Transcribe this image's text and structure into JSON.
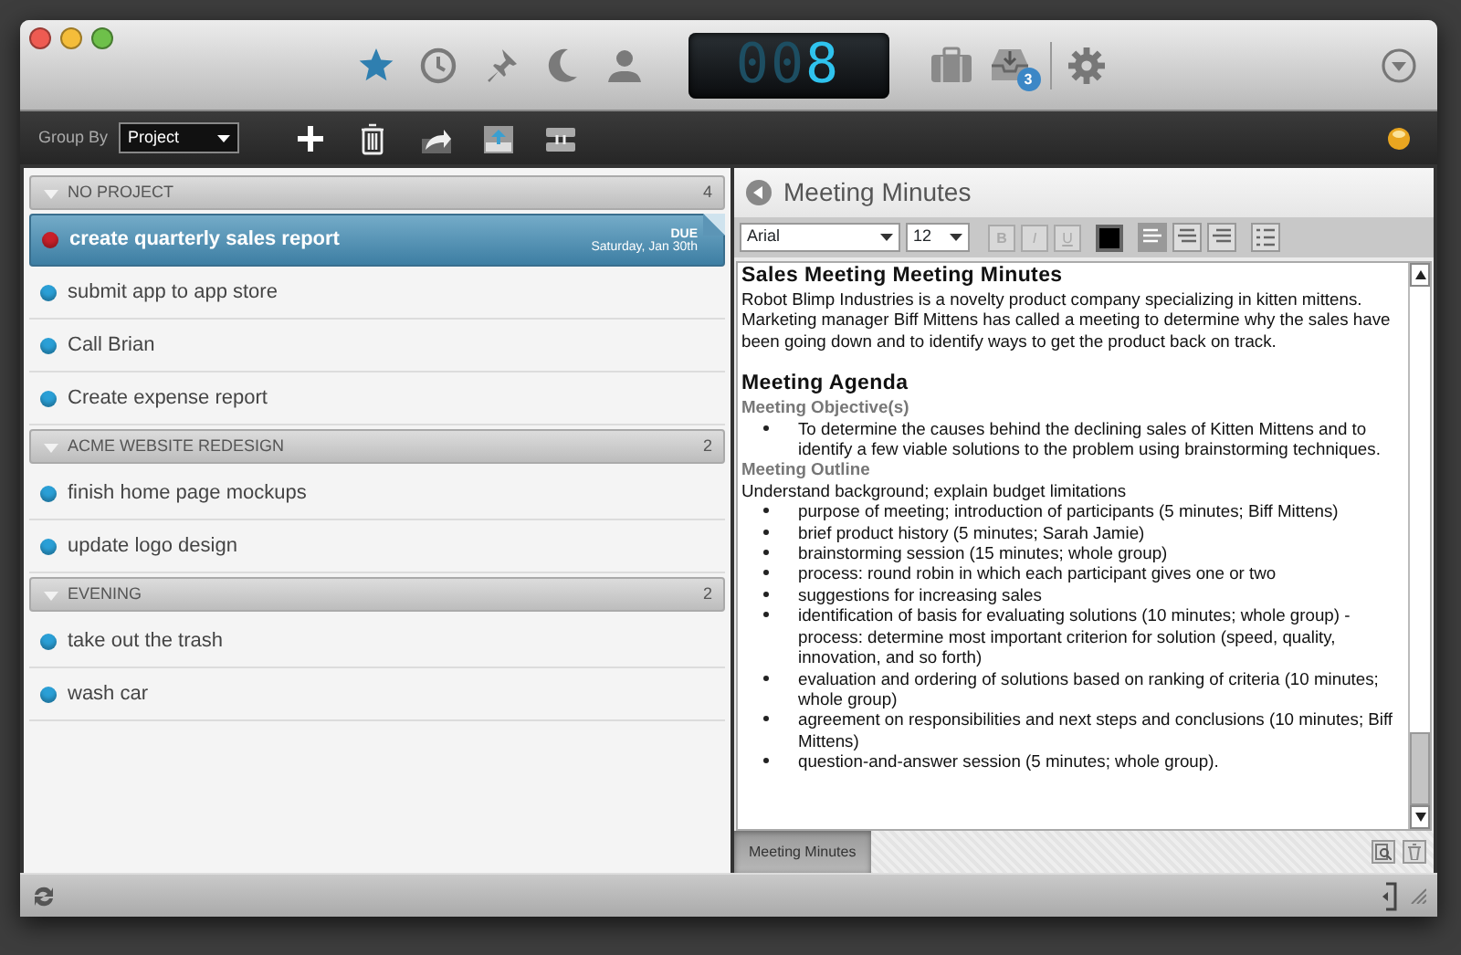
{
  "toolbar": {
    "views": [
      {
        "kind": "star",
        "selected": true
      },
      {
        "kind": "clock",
        "selected": false
      },
      {
        "kind": "pin",
        "selected": false
      },
      {
        "kind": "moon",
        "selected": false
      },
      {
        "kind": "person",
        "selected": false
      }
    ],
    "counter": "008",
    "inbox_badge": "3"
  },
  "group_by": {
    "label": "Group By",
    "value": "Project"
  },
  "sections": [
    {
      "title": "NO PROJECT",
      "count": "4",
      "expanded": true,
      "tasks": [
        {
          "title": "create quarterly sales report",
          "selected": true,
          "color": "#c8202a",
          "due_label": "DUE",
          "due_date": "Saturday, Jan 30th"
        },
        {
          "title": "submit app to app store",
          "selected": false,
          "color": "#2a9fd6"
        },
        {
          "title": "Call Brian",
          "selected": false,
          "color": "#2a9fd6"
        },
        {
          "title": "Create expense report",
          "selected": false,
          "color": "#2a9fd6"
        }
      ]
    },
    {
      "title": "ACME WEBSITE REDESIGN",
      "count": "2",
      "expanded": true,
      "tasks": [
        {
          "title": "finish home page mockups",
          "selected": false,
          "color": "#2a9fd6"
        },
        {
          "title": "update logo design",
          "selected": false,
          "color": "#2a9fd6"
        }
      ]
    },
    {
      "title": "EVENING",
      "count": "2",
      "expanded": true,
      "tasks": [
        {
          "title": "take out the trash",
          "selected": false,
          "color": "#2a9fd6"
        },
        {
          "title": "wash car",
          "selected": false,
          "color": "#2a9fd6"
        }
      ]
    }
  ],
  "note": {
    "title": "Meeting Minutes",
    "editor": {
      "font": "Arial",
      "size": "12",
      "format_buttons": [
        {
          "label": "B",
          "disabled": true
        },
        {
          "label": "I",
          "disabled": true
        },
        {
          "label": "U",
          "disabled": true
        }
      ],
      "align_buttons": [
        {
          "kind": "left",
          "selected": true
        },
        {
          "kind": "center",
          "selected": false
        },
        {
          "kind": "right",
          "selected": false
        }
      ]
    },
    "content": [
      {
        "kind": "heading",
        "text": "Sales Meeting Meeting Minutes"
      },
      {
        "kind": "paragraph",
        "text": "Robot Blimp Industries is a novelty product company specializing in kitten mittens. Marketing manager Biff Mittens has called a meeting to determine why the sales have been going down and to identify ways to get the product back on track."
      },
      {
        "kind": "spacer"
      },
      {
        "kind": "heading",
        "text": "Meeting Agenda"
      },
      {
        "kind": "subheading",
        "text": "Meeting Objective(s)"
      },
      {
        "kind": "bullet",
        "text": "To determine the causes behind the declining sales of Kitten Mittens and to identify a few viable solutions to the problem using brainstorming techniques."
      },
      {
        "kind": "subheading",
        "text": "Meeting Outline"
      },
      {
        "kind": "paragraph",
        "text": "Understand background; explain budget limitations"
      },
      {
        "kind": "bullet",
        "text": "purpose of meeting; introduction of participants (5 minutes; Biff Mittens)"
      },
      {
        "kind": "bullet",
        "text": "brief product history (5 minutes; Sarah Jamie)"
      },
      {
        "kind": "bullet",
        "text": "brainstorming session (15 minutes; whole group)"
      },
      {
        "kind": "bullet",
        "text": "process: round robin in which each participant gives one or two"
      },
      {
        "kind": "bullet",
        "text": "suggestions for increasing sales"
      },
      {
        "kind": "bullet",
        "text": "identification of basis for evaluating solutions (10 minutes; whole group) -process: determine most important criterion for solution (speed, quality, innovation, and so forth)"
      },
      {
        "kind": "bullet",
        "text": "evaluation and ordering of solutions based on ranking of criteria (10 minutes; whole group)"
      },
      {
        "kind": "bullet",
        "text": "agreement on responsibilities and next steps and conclusions (10 minutes; Biff Mittens)"
      },
      {
        "kind": "bullet",
        "text": "question-and-answer session (5 minutes; whole group)."
      }
    ],
    "tabs": [
      {
        "label": "Meeting Minutes",
        "selected": true
      }
    ]
  }
}
